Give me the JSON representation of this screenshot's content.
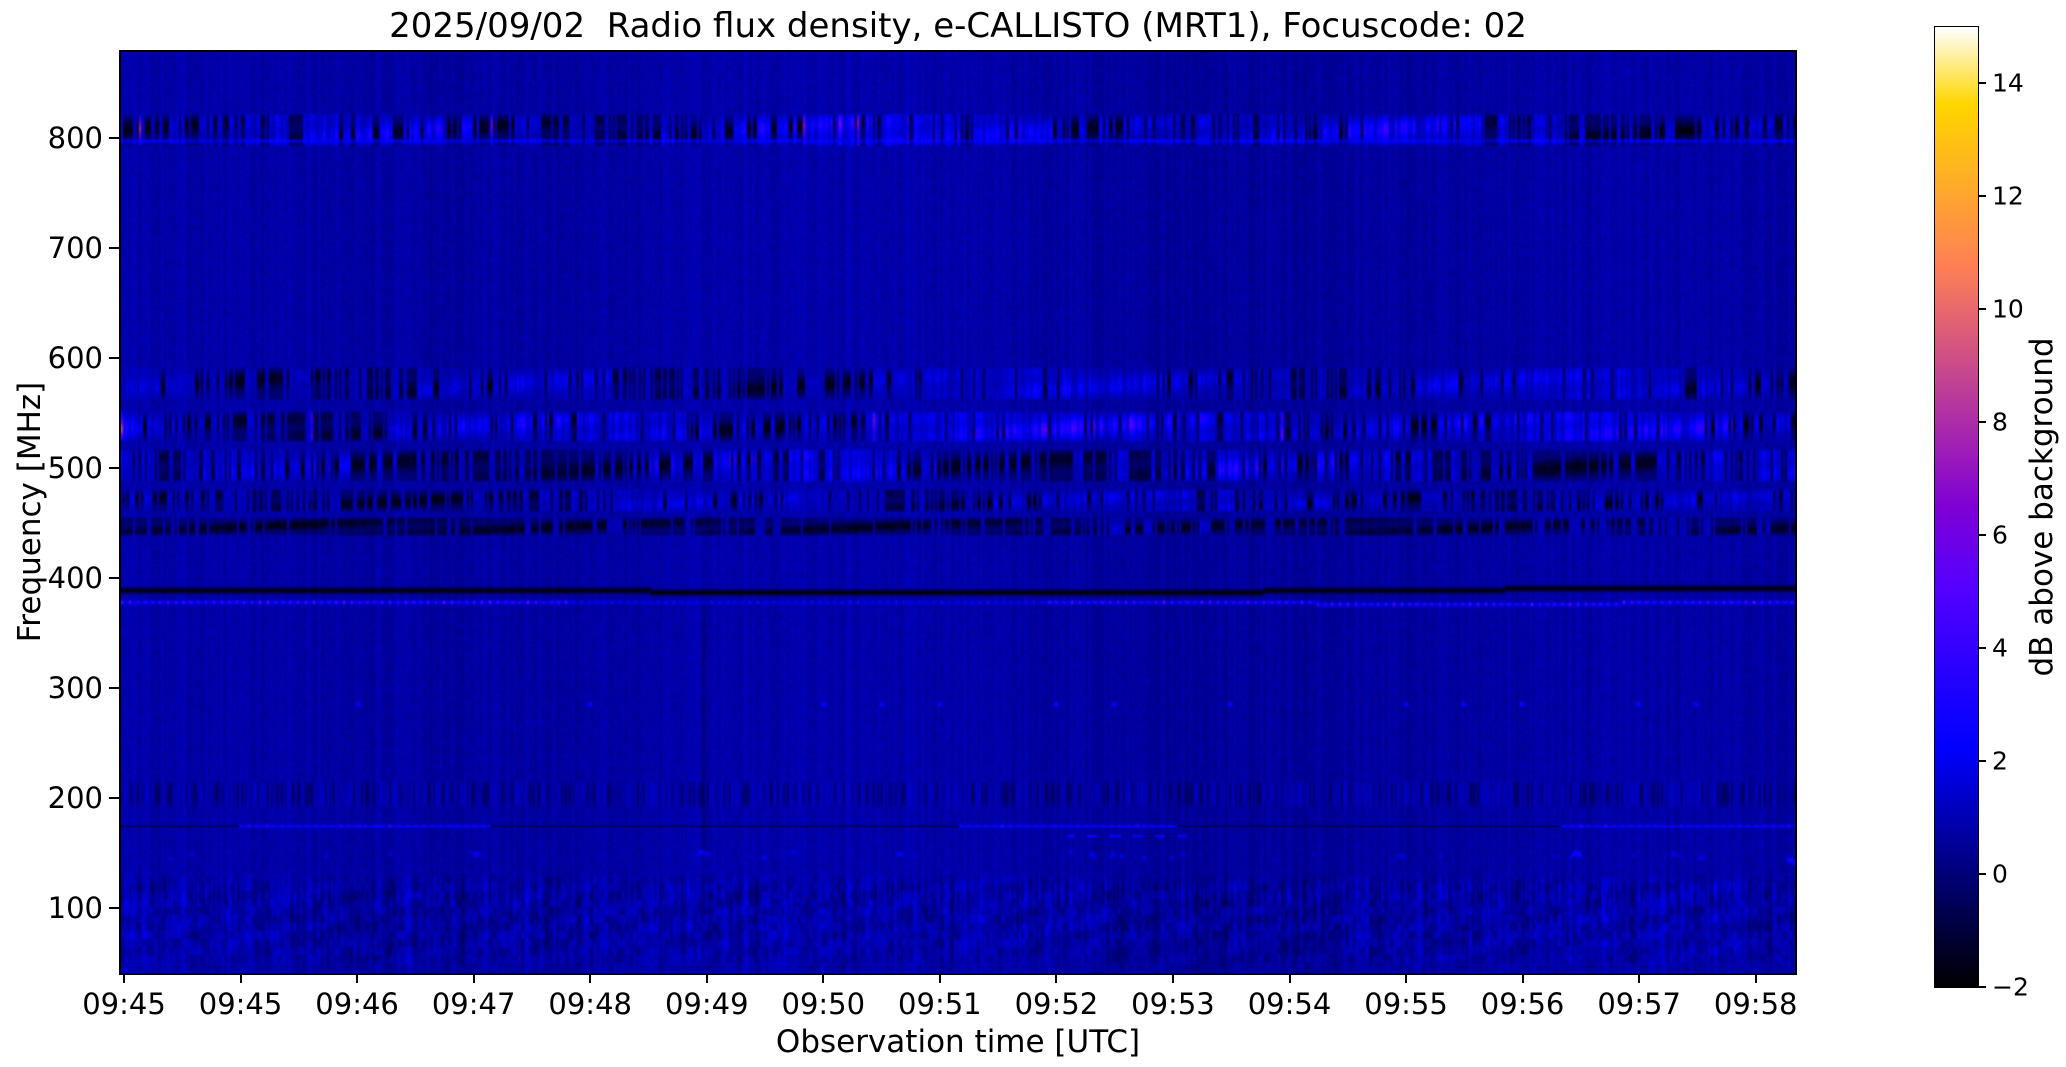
{
  "chart_data": {
    "type": "heatmap",
    "title": "2025/09/02  Radio flux density, e-CALLISTO (MRT1), Focuscode: 02",
    "xlabel": "Observation time [UTC]",
    "ylabel": "Frequency [MHz]",
    "x_ticks": [
      "09:45",
      "09:45",
      "09:46",
      "09:47",
      "09:48",
      "09:49",
      "09:50",
      "09:51",
      "09:52",
      "09:53",
      "09:54",
      "09:55",
      "09:56",
      "09:57",
      "09:58"
    ],
    "y_ticks": [
      800,
      700,
      600,
      500,
      400,
      300,
      200,
      100
    ],
    "y_range_mhz": [
      41,
      878
    ],
    "grid": false,
    "colorbar": {
      "label": "dB above background",
      "min": -2,
      "max": 15,
      "ticks": [
        14,
        12,
        10,
        8,
        6,
        4,
        2,
        0,
        -2
      ],
      "tick_labels": [
        "14",
        "12",
        "10",
        "8",
        "6",
        "4",
        "2",
        "0",
        "−2"
      ],
      "colormap": "gnuplot2",
      "position": "right"
    },
    "background_db": 0.7,
    "bands": [
      {
        "name": "uhf-interference-band-800",
        "f_lo": 793,
        "f_hi": 823,
        "style": "speckle",
        "amp": 3.2,
        "dark": 0.42,
        "pink": 0.004
      },
      {
        "name": "carrier-line-797",
        "f_lo": 795.5,
        "f_hi": 799,
        "style": "bright_line",
        "db": 2.6
      },
      {
        "name": "band-575",
        "f_lo": 563,
        "f_hi": 592,
        "style": "speckle",
        "amp": 1.9,
        "dark": 0.34,
        "pink": 0.0
      },
      {
        "name": "band-540",
        "f_lo": 524,
        "f_hi": 553,
        "style": "speckle",
        "amp": 3.6,
        "dark": 0.36,
        "pink": 0.012
      },
      {
        "name": "band-500",
        "f_lo": 489,
        "f_hi": 517,
        "style": "speckle",
        "amp": 3.0,
        "dark": 0.52,
        "pink": 0.003
      },
      {
        "name": "band-470",
        "f_lo": 462,
        "f_hi": 481,
        "style": "speckle",
        "amp": 1.6,
        "dark": 0.42,
        "pink": 0.0
      },
      {
        "name": "band-447",
        "f_lo": 440,
        "f_hi": 455,
        "style": "speckle",
        "amp": 0.8,
        "dark": 0.62,
        "pink": 0.0
      },
      {
        "name": "absorption-line-388",
        "f_lo": 384,
        "f_hi": 393,
        "style": "dark_line",
        "db": -1.95
      },
      {
        "name": "beacon-line-378",
        "f_lo": 375,
        "f_hi": 382,
        "style": "dotted_line",
        "segments": [
          [
            0.0,
            0.27,
            1.0
          ],
          [
            0.27,
            0.55,
            0.45
          ],
          [
            0.55,
            1.0,
            1.0
          ]
        ]
      },
      {
        "name": "dot-row-286",
        "f_lo": 284,
        "f_hi": 288,
        "style": "dots",
        "db": 2.4
      },
      {
        "name": "texture-band-205",
        "f_lo": 193,
        "f_hi": 216,
        "style": "stripes",
        "amp": 0.55
      },
      {
        "name": "line-174",
        "f_lo": 173,
        "f_hi": 176,
        "style": "mixed_line",
        "bright": [
          [
            0.07,
            0.22
          ],
          [
            0.5,
            0.63
          ],
          [
            0.86,
            1.0
          ]
        ]
      },
      {
        "name": "dash-row-167",
        "f_lo": 165,
        "f_hi": 169,
        "style": "dashes",
        "db": 2.6,
        "range": [
          0.565,
          0.645
        ]
      },
      {
        "name": "blob-row-150",
        "f_lo": 142,
        "f_hi": 158,
        "style": "blobs",
        "db": 2.2
      },
      {
        "name": "low-band-noise",
        "f_lo": 43,
        "f_hi": 132,
        "style": "mottle",
        "amp": 1.0
      },
      {
        "name": "vertical-streak-0951",
        "x": 0.348,
        "f_lo": 150,
        "f_hi": 380,
        "style": "vstreak",
        "db": -0.5
      }
    ]
  }
}
